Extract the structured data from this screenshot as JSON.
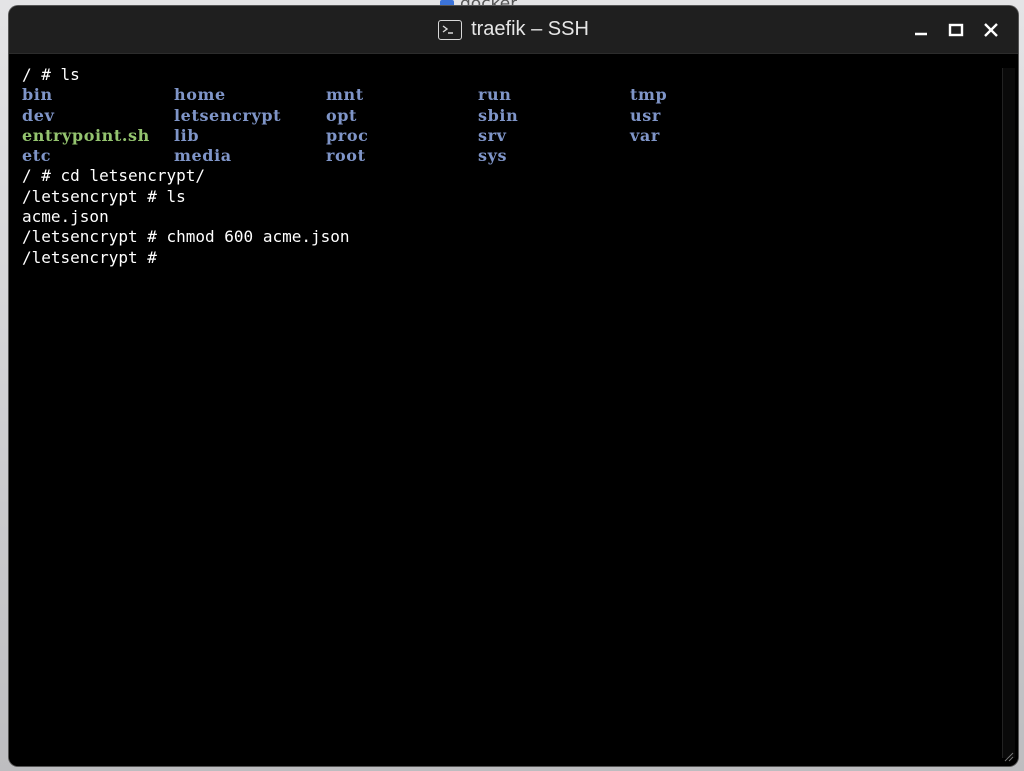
{
  "background": {
    "tab_label": "docker"
  },
  "window": {
    "title": "traefik – SSH",
    "icon": "terminal-icon",
    "controls": {
      "minimize_icon": "minimize-icon",
      "maximize_icon": "maximize-icon",
      "close_icon": "close-icon"
    }
  },
  "terminal": {
    "colors": {
      "background": "#000000",
      "text": "#ffffff",
      "directory": "#7f95c8",
      "executable": "#94c46f"
    },
    "line_1": "/ # ls",
    "listing": [
      [
        {
          "name": "bin",
          "kind": "directory"
        },
        {
          "name": "home",
          "kind": "directory"
        },
        {
          "name": "mnt",
          "kind": "directory"
        },
        {
          "name": "run",
          "kind": "directory"
        },
        {
          "name": "tmp",
          "kind": "directory"
        }
      ],
      [
        {
          "name": "dev",
          "kind": "directory"
        },
        {
          "name": "letsencrypt",
          "kind": "directory"
        },
        {
          "name": "opt",
          "kind": "directory"
        },
        {
          "name": "sbin",
          "kind": "directory"
        },
        {
          "name": "usr",
          "kind": "directory"
        }
      ],
      [
        {
          "name": "entrypoint.sh",
          "kind": "executable"
        },
        {
          "name": "lib",
          "kind": "directory"
        },
        {
          "name": "proc",
          "kind": "directory"
        },
        {
          "name": "srv",
          "kind": "directory"
        },
        {
          "name": "var",
          "kind": "directory"
        }
      ],
      [
        {
          "name": "etc",
          "kind": "directory"
        },
        {
          "name": "media",
          "kind": "directory"
        },
        {
          "name": "root",
          "kind": "directory"
        },
        {
          "name": "sys",
          "kind": "directory"
        }
      ]
    ],
    "lines_after": [
      "/ # cd letsencrypt/",
      "/letsencrypt # ls",
      "acme.json",
      "/letsencrypt # chmod 600 acme.json",
      "/letsencrypt # "
    ]
  }
}
